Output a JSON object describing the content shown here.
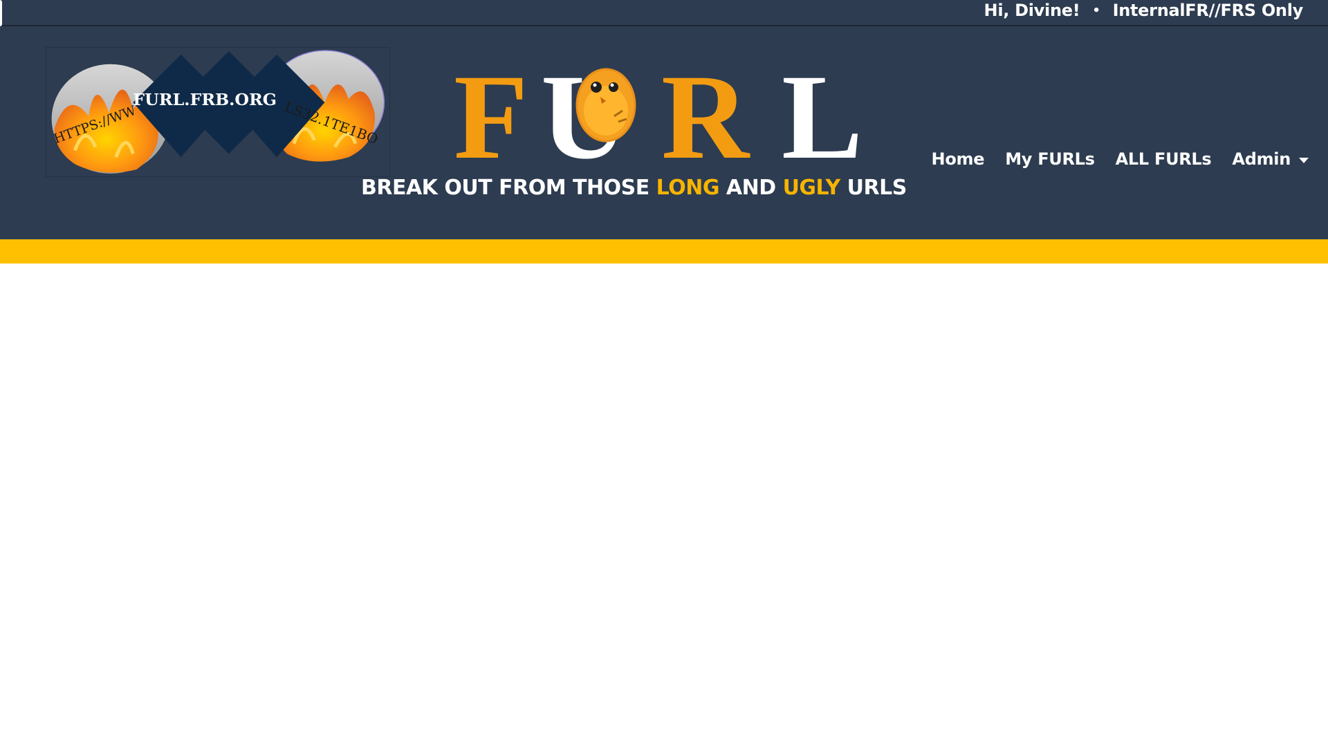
{
  "topbar": {
    "greeting": "Hi, Divine!",
    "separator": "•",
    "classification": "InternalFR//FRS Only"
  },
  "logo": {
    "center_text": "FURL.FRB.ORG",
    "left_text": "HTTPS://WW",
    "right_text": "LS32.1TE1BO"
  },
  "brand": {
    "letters": [
      "F",
      "U",
      "R",
      "L"
    ],
    "tagline_parts": [
      "BREAK OUT FROM THOSE ",
      "LONG",
      " AND ",
      "UGLY",
      " URLS"
    ]
  },
  "nav": {
    "home": "Home",
    "my_furls": "My FURLs",
    "all_furls": "ALL FURLs",
    "admin": "Admin"
  },
  "colors": {
    "header_bg": "#2d3c50",
    "accent_yellow": "#fec000",
    "brand_orange": "#f39c12"
  }
}
